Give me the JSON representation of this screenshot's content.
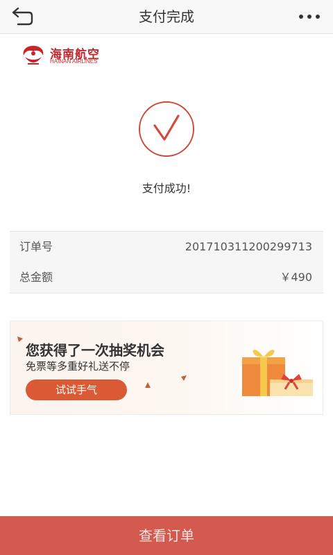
{
  "header": {
    "title": "支付完成",
    "back_icon": "back-arrow-icon",
    "more_icon": "more-dots-icon"
  },
  "brand": {
    "name_cn": "海南航空",
    "name_en": "HAINAN AIRLINES",
    "color": "#c7252c"
  },
  "status": {
    "message": "支付成功!",
    "icon": "check-circle-icon",
    "color": "#cf4a3c"
  },
  "order": {
    "rows": [
      {
        "label": "订单号",
        "value": "201710311200299713"
      },
      {
        "label": "总金额",
        "value": "￥490"
      }
    ]
  },
  "promo": {
    "title": "您获得了一次抽奖机会",
    "subtitle": "免票等多重好礼送不停",
    "button_label": "试试手气",
    "icon": "gift-box-icon",
    "accent": "#d95a34"
  },
  "footer": {
    "button_label": "查看订单",
    "color": "#d45a50"
  }
}
